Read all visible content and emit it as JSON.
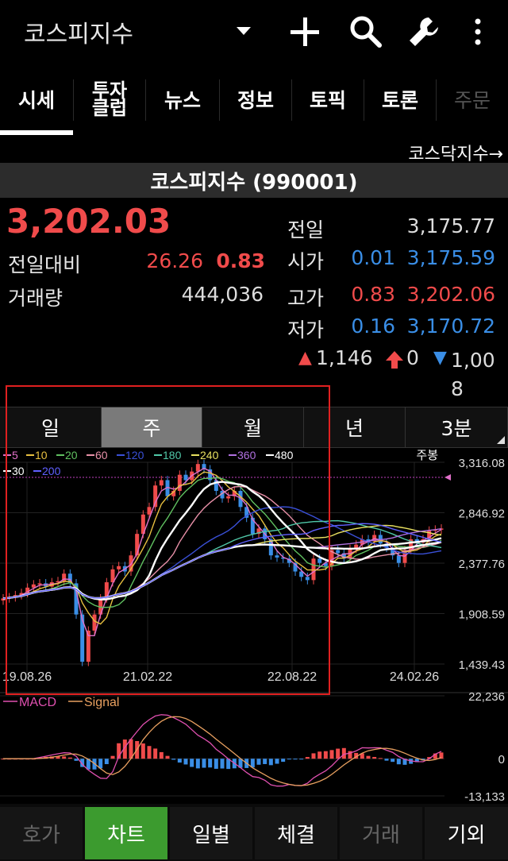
{
  "app": {
    "title": "코스피지수",
    "icons": [
      "dropdown-icon",
      "add-icon",
      "search-icon",
      "wrench-icon",
      "more-vertical-icon"
    ]
  },
  "tabs": [
    {
      "label": "시세",
      "active": true
    },
    {
      "label": "투자\n클럽",
      "active": false
    },
    {
      "label": "뉴스",
      "active": false
    },
    {
      "label": "정보",
      "active": false
    },
    {
      "label": "토픽",
      "active": false
    },
    {
      "label": "토론",
      "active": false
    },
    {
      "label": "주문",
      "active": false
    }
  ],
  "kosdaq_link": "코스닥지수→",
  "index_name": "코스피지수 (990001)",
  "quote": {
    "price": "3,202.03",
    "change_label": "전일대비",
    "change_value": "26.26",
    "change_pct": "0.83",
    "volume_label": "거래량",
    "volume_value": "444,036",
    "prev_label": "전일",
    "prev_value": "3,175.77",
    "open_label": "시가",
    "open_pct": "0.01",
    "open_value": "3,175.59",
    "high_label": "고가",
    "high_pct": "0.83",
    "high_value": "3,202.06",
    "low_label": "저가",
    "low_pct": "0.16",
    "low_value": "3,170.72",
    "up_count": "1,146",
    "limit_up_count": "0",
    "down_count": "1,00\n8"
  },
  "periods": [
    {
      "label": "일",
      "active": false
    },
    {
      "label": "주",
      "active": true
    },
    {
      "label": "월",
      "active": false
    },
    {
      "label": "년",
      "active": false
    },
    {
      "label": "3분",
      "active": false
    }
  ],
  "chart_data": {
    "type": "line",
    "series_type": "candlestick with moving averages (weekly)",
    "ma_legend": [
      {
        "name": "5",
        "color": "#e070c8"
      },
      {
        "name": "10",
        "color": "#e8c040"
      },
      {
        "name": "20",
        "color": "#60c060"
      },
      {
        "name": "60",
        "color": "#e890a8"
      },
      {
        "name": "120",
        "color": "#3a50d8"
      },
      {
        "name": "180",
        "color": "#50c8a8"
      },
      {
        "name": "240",
        "color": "#e8e060"
      },
      {
        "name": "360",
        "color": "#b070e0"
      },
      {
        "name": "480",
        "color": "#ffffff"
      },
      {
        "name": "30",
        "color": "#ffffff"
      },
      {
        "name": "200",
        "color": "#6060ff"
      }
    ],
    "period_label": "주봉",
    "y_ticks": [
      "3,316.08",
      "2,846.92",
      "2,377.76",
      "1,908.59",
      "1,439.43"
    ],
    "x_ticks": [
      "19.08.26",
      "21.02.22",
      "22.08.22",
      "24.02.26"
    ],
    "ylim": [
      1439.43,
      3316.08
    ],
    "price_close": [
      2050,
      2060,
      2080,
      2100,
      2150,
      2180,
      2190,
      2160,
      2200,
      2210,
      2280,
      2190,
      1900,
      1460,
      1750,
      1900,
      2050,
      2200,
      2320,
      2350,
      2300,
      2450,
      2650,
      2830,
      2900,
      3100,
      3150,
      3000,
      3050,
      3200,
      3150,
      3230,
      3300,
      3250,
      3150,
      3050,
      2980,
      3000,
      3050,
      2900,
      2800,
      2650,
      2700,
      2600,
      2450,
      2430,
      2420,
      2380,
      2300,
      2250,
      2220,
      2420,
      2380,
      2350,
      2500,
      2470,
      2420,
      2510,
      2550,
      2600,
      2580,
      2640,
      2560,
      2520,
      2450,
      2380,
      2500,
      2600,
      2570,
      2600,
      2680,
      2690,
      2700
    ],
    "macd_legend": [
      {
        "name": "MACD",
        "color": "#e050b0"
      },
      {
        "name": "Signal",
        "color": "#e8a060"
      }
    ],
    "macd_ticks": [
      "22,236",
      "0",
      "-13,133"
    ],
    "macd_ylim": [
      -13133,
      22236
    ]
  },
  "bottom_tabs": [
    {
      "label": "호가",
      "active": false,
      "dim": true
    },
    {
      "label": "차트",
      "active": true,
      "dim": false
    },
    {
      "label": "일별",
      "active": false,
      "dim": false
    },
    {
      "label": "체결",
      "active": false,
      "dim": false
    },
    {
      "label": "거래",
      "active": false,
      "dim": true
    },
    {
      "label": "기외",
      "active": false,
      "dim": false
    }
  ]
}
